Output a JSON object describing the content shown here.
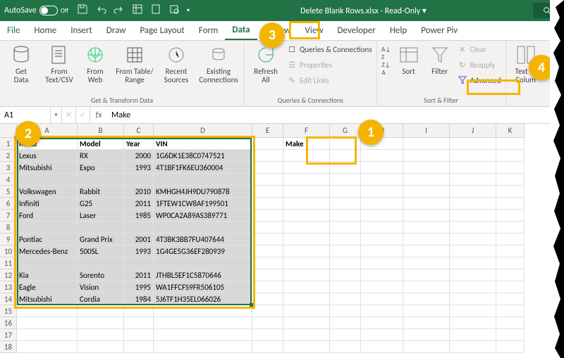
{
  "titlebar": {
    "autosave": "AutoSave",
    "autosave_state": "Off",
    "filename": "Delete Blank Rows.xlsx",
    "mode": "Read-Only"
  },
  "tabs": {
    "file": "File",
    "items": [
      "Home",
      "Insert",
      "Draw",
      "Page Layout",
      "Form",
      "Data",
      "Review",
      "View",
      "Developer",
      "Help",
      "Power Piv"
    ],
    "active_index": 5
  },
  "ribbon": {
    "group_transform": {
      "get_data": "Get\nData",
      "from_textcsv": "From\nText/CSV",
      "from_web": "From\nWeb",
      "from_table_range": "From Table/\nRange",
      "recent_sources": "Recent\nSources",
      "existing_conn": "Existing\nConnections",
      "label": "Get & Transform Data"
    },
    "group_queries": {
      "refresh_all": "Refresh\nAll",
      "queries_connections": "Queries & Connections",
      "properties": "Properties",
      "edit_links": "Edit Links",
      "label": "Queries & Connections"
    },
    "group_sort": {
      "sort": "Sort",
      "filter": "Filter",
      "clear": "Clear",
      "reapply": "Reapply",
      "advanced": "Advanced",
      "label": "Sort & Filter"
    },
    "group_tools": {
      "text_to_columns": "Text to\nColum"
    }
  },
  "formula_bar": {
    "namebox": "A1",
    "fx_label": "fx",
    "value": "Make"
  },
  "columns": [
    "A",
    "B",
    "C",
    "D",
    "E",
    "F",
    "G",
    "H",
    "I",
    "J",
    "K"
  ],
  "table": {
    "headers": [
      "Make",
      "Model",
      "Year",
      "VIN"
    ],
    "rows": [
      [
        "Lexus",
        "RX",
        "2000",
        "1G6DK1E38C0747521"
      ],
      [
        "Mitsubishi",
        "Expo",
        "1993",
        "4T1BF1FK6EU360004"
      ],
      [
        "",
        "",
        "",
        ""
      ],
      [
        "Volkswagen",
        "Rabbit",
        "2010",
        "KMHGH4JH9DU790878"
      ],
      [
        "Infiniti",
        "G25",
        "2011",
        "1FTEW1CW8AF199501"
      ],
      [
        "Ford",
        "Laser",
        "1985",
        "WP0CA2A89AS389771"
      ],
      [
        "",
        "",
        "",
        ""
      ],
      [
        "Pontiac",
        "Grand Prix",
        "2001",
        "4T3BK3BB7FU407644"
      ],
      [
        "Mercedes-Benz",
        "500SL",
        "1993",
        "1G4GE5G36EF280939"
      ],
      [
        "",
        "",
        "",
        ""
      ],
      [
        "Kia",
        "Sorento",
        "2011",
        "JTHBL5EF1C5870646"
      ],
      [
        "Eagle",
        "Vision",
        "1995",
        "WA1FFCFS9FR506105"
      ],
      [
        "Mitsubishi",
        "Cordia",
        "1984",
        "5J6TF1H35EL066026"
      ]
    ]
  },
  "criteria": {
    "f1": "Make"
  },
  "callouts": [
    "1",
    "2",
    "3",
    "4"
  ]
}
